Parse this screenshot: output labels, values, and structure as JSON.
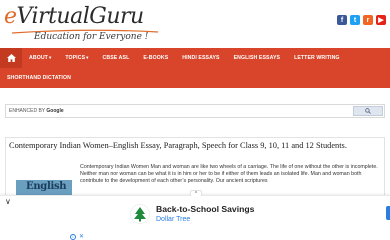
{
  "header": {
    "logo_prefix": "e",
    "logo_main": "VirtualGuru",
    "logo_tagline": "Education for Everyone !",
    "social": [
      {
        "icon": "facebook-icon",
        "glyph": "f"
      },
      {
        "icon": "twitter-icon",
        "glyph": "t"
      },
      {
        "icon": "rss-icon",
        "glyph": "r"
      },
      {
        "icon": "youtube-icon",
        "glyph": "▶"
      }
    ]
  },
  "nav": {
    "row1": [
      "ABOUT",
      "TOPICS",
      "CBSE ASL",
      "E-BOOKS",
      "HINDI ESSAYS",
      "ENGLISH ESSAYS",
      "LETTER WRITING"
    ],
    "row1_caret": [
      "▾",
      "▾",
      "",
      "",
      "",
      "",
      ""
    ],
    "row2": [
      "SHORTHAND DICTATION"
    ]
  },
  "search": {
    "label_enhanced": "ENHANCED BY",
    "label_google": "Google"
  },
  "article": {
    "title": "Contemporary Indian Women–English Essay, Paragraph, Speech for Class 9, 10, 11 and 12 Students.",
    "thumb_text": "English",
    "body": "Contemporary Indian Women Man and woman are like two wheels of a carriage. The life of one without the other is incomplete. Neither man nor woman can be what it is in him or her to be if either of them leads an isolated life. Man and woman both contribute to the development of each other’s personality. Our ancient scriptures"
  },
  "ad": {
    "title": "Back-to-School Savings",
    "advertiser": "Dollar Tree",
    "chevron": "∨",
    "collapse": "^"
  },
  "colors": {
    "nav_bg": "#d8452a",
    "accent_orange": "#e06b2a",
    "link_blue": "#2a7de1"
  }
}
